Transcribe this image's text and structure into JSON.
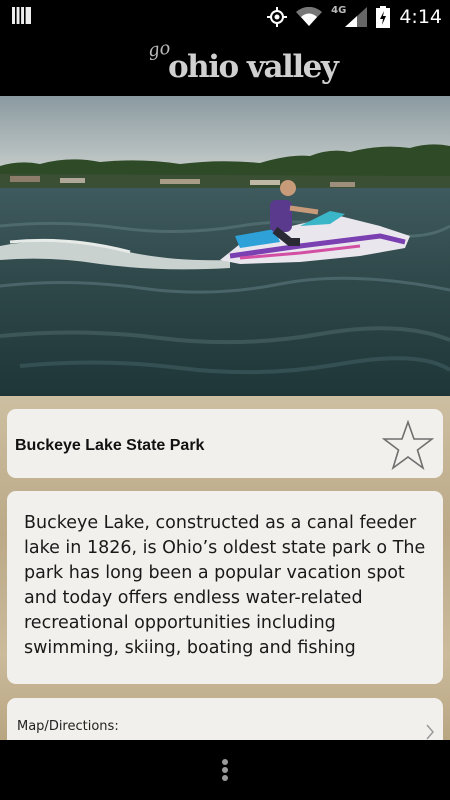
{
  "status_bar": {
    "time": "4:14",
    "network": "4G",
    "icons": [
      "notification-icon",
      "gps-icon",
      "wifi-icon",
      "signal-icon",
      "battery-icon"
    ]
  },
  "header": {
    "logo_go": "go",
    "logo_name": "ohio valley"
  },
  "hero": {
    "subject": "person riding a jet ski on a lake"
  },
  "park": {
    "title": "Buckeye Lake State Park",
    "favorite_icon": "star-outline-icon",
    "description_lines": [
      "Buckeye Lake, constructed as a canal feeder",
      "lake in 1826, is Ohio’s oldest state park o The",
      "park has long been a popular vacation spot",
      "and today offers endless water-related",
      "recreational opportunities including",
      "swimming, skiing, boating and fishing"
    ]
  },
  "map": {
    "label": "Map/Directions:"
  },
  "nav": {
    "menu_icon": "overflow-menu-icon"
  },
  "colors": {
    "card_bg": "#f2f0ec",
    "parchment": "#c4b393",
    "bars": "#000000"
  }
}
